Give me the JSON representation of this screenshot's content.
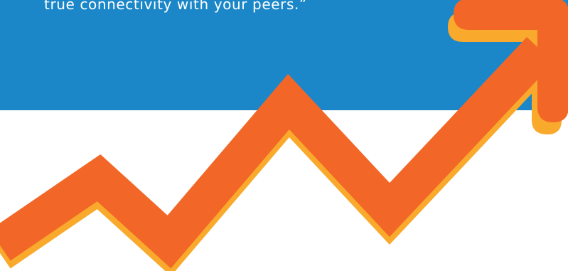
{
  "banner": {
    "quote_line": "true connectivity with your peers.”"
  },
  "colors": {
    "band": "#1b87c9",
    "arrow": "#f26727",
    "arrow_shadow": "#f9a92b",
    "text": "#ffffff",
    "background": "#ffffff"
  },
  "graphic": {
    "icon": "trend-up-arrow-icon"
  }
}
